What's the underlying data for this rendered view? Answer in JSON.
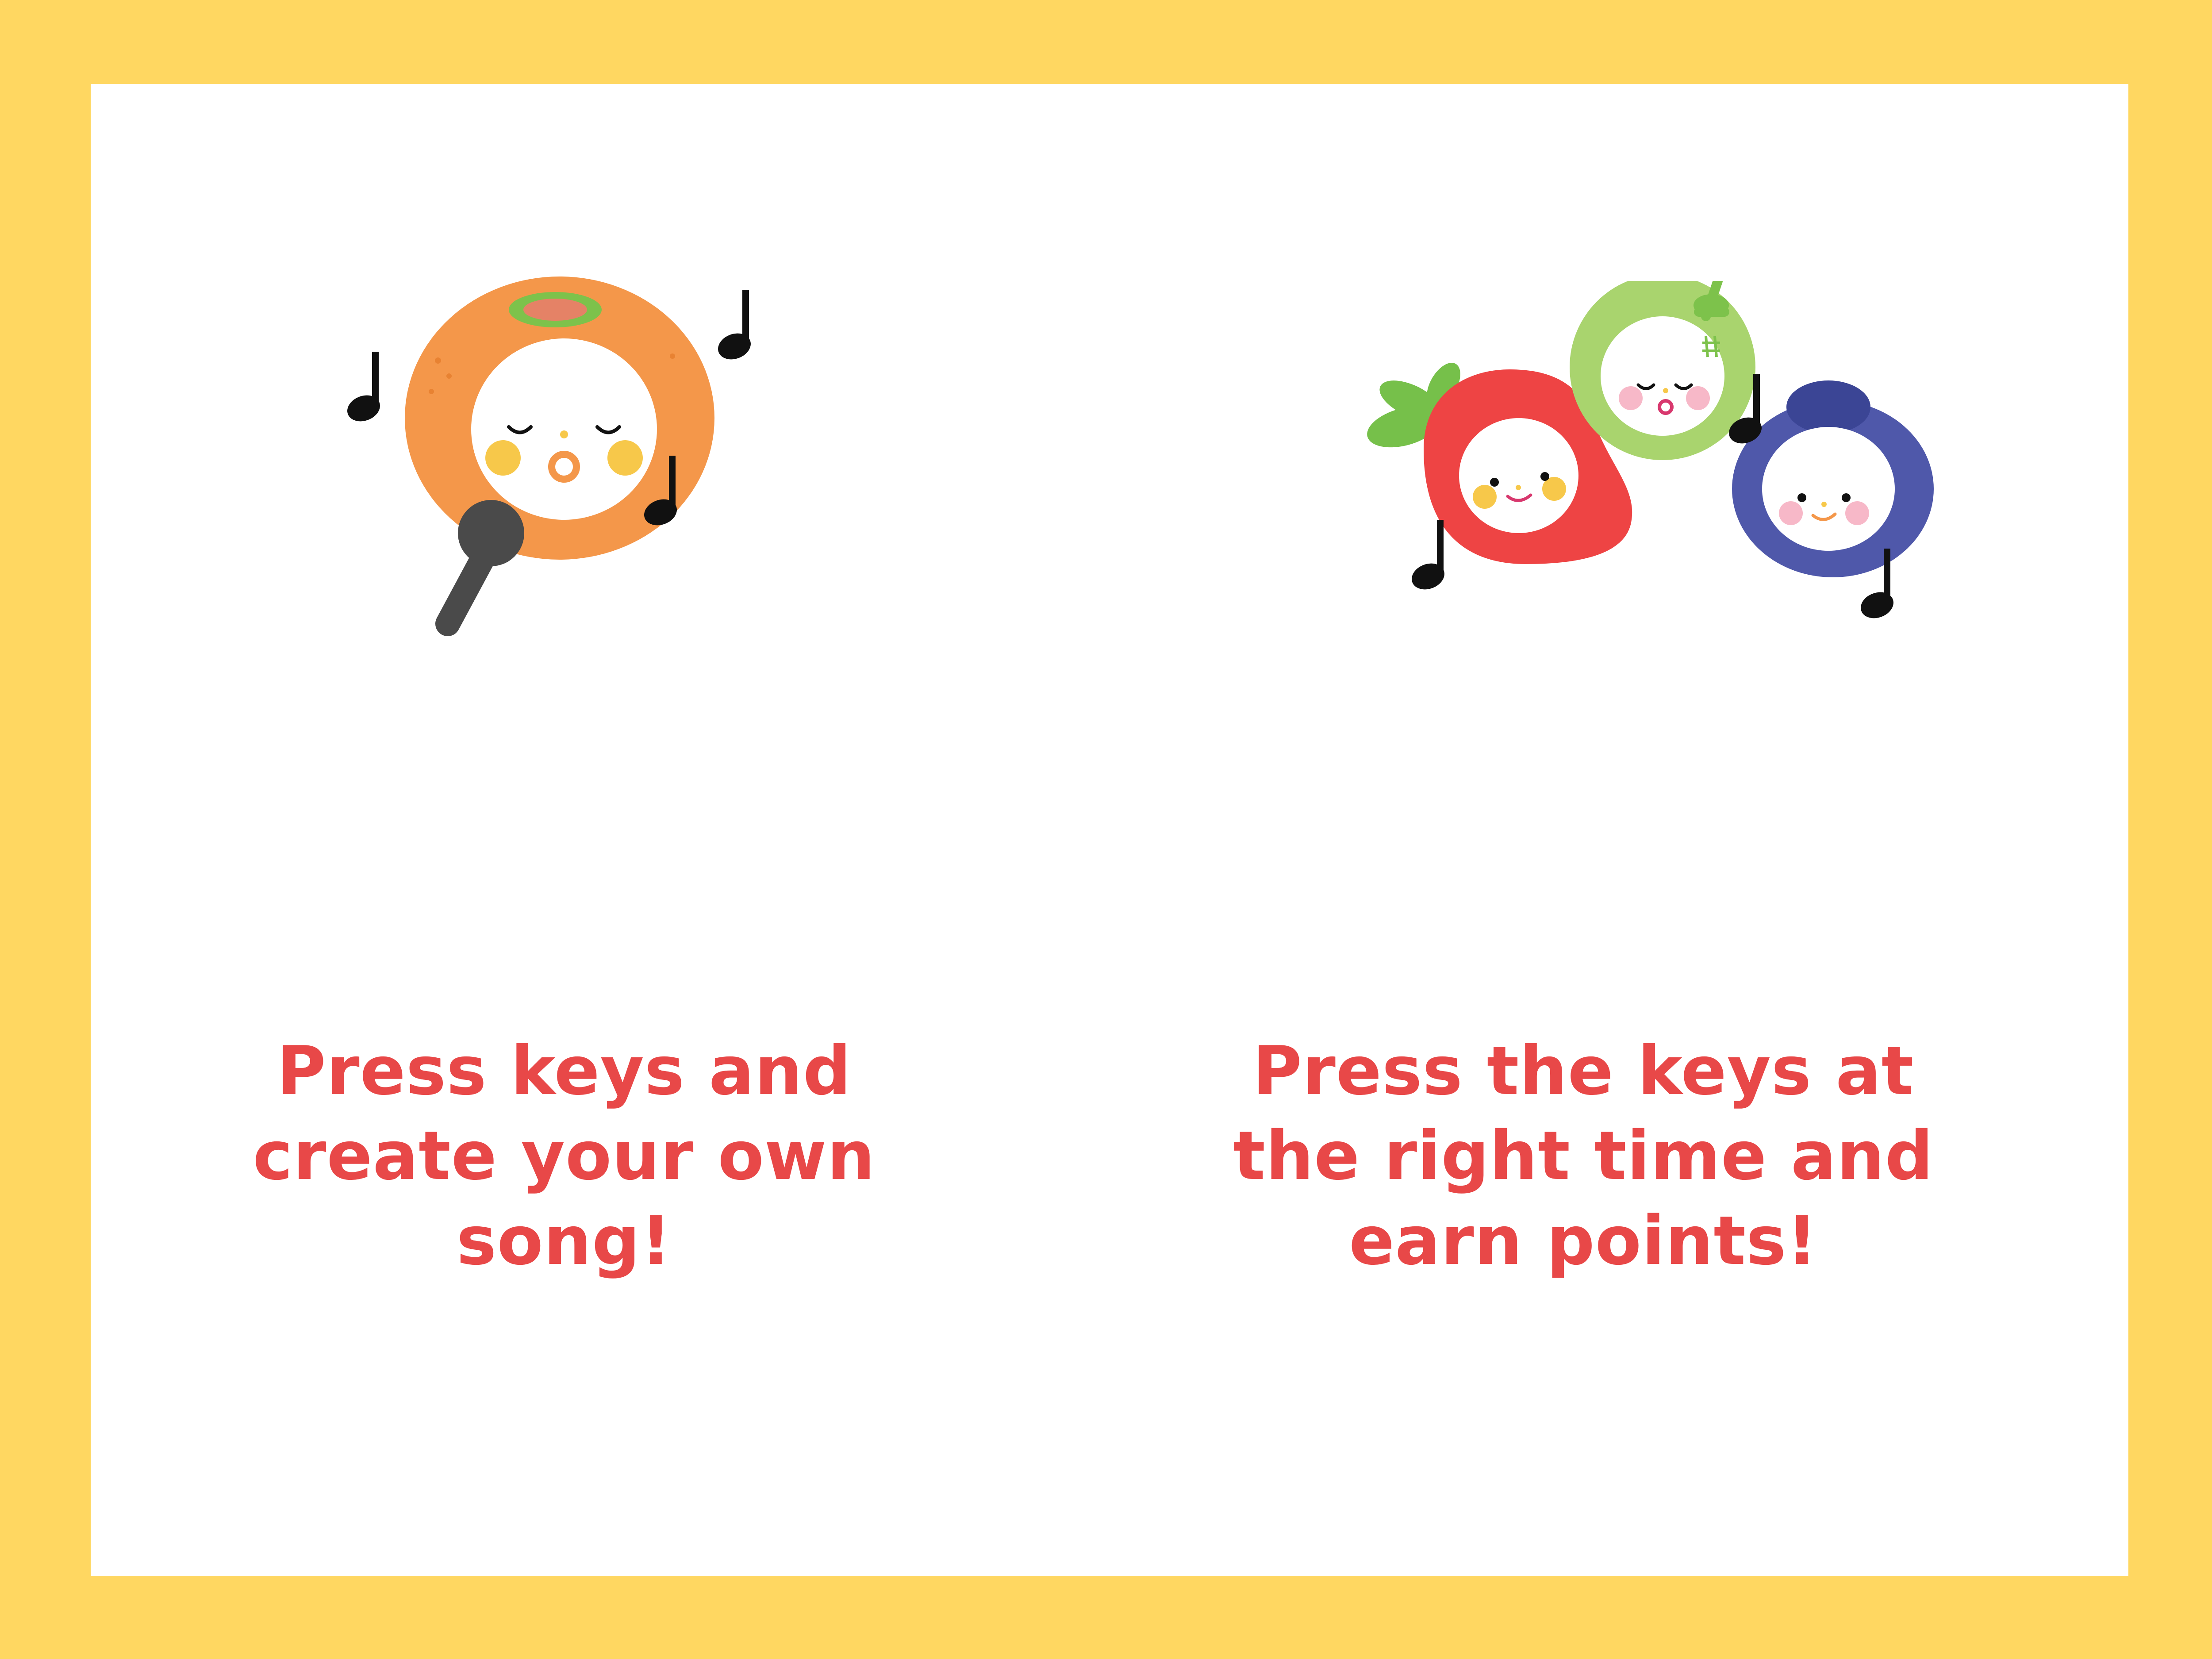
{
  "colors": {
    "frame": "#FFD761",
    "panel": "#FFFFFF",
    "caption": "#E84848",
    "orange": "#F4974A",
    "strawberry": "#EE4444",
    "melon": "#A9D46E",
    "blueberry": "#4F58AA",
    "note": "#111111"
  },
  "modes": {
    "free_play": {
      "caption_lines": [
        "Press keys and",
        "create your own",
        "song!"
      ],
      "icon": "singing-orange-icon"
    },
    "rhythm": {
      "caption_lines": [
        "Press the keys at",
        "the right time and",
        "earn points!"
      ],
      "icon": "fruit-trio-icon"
    }
  }
}
